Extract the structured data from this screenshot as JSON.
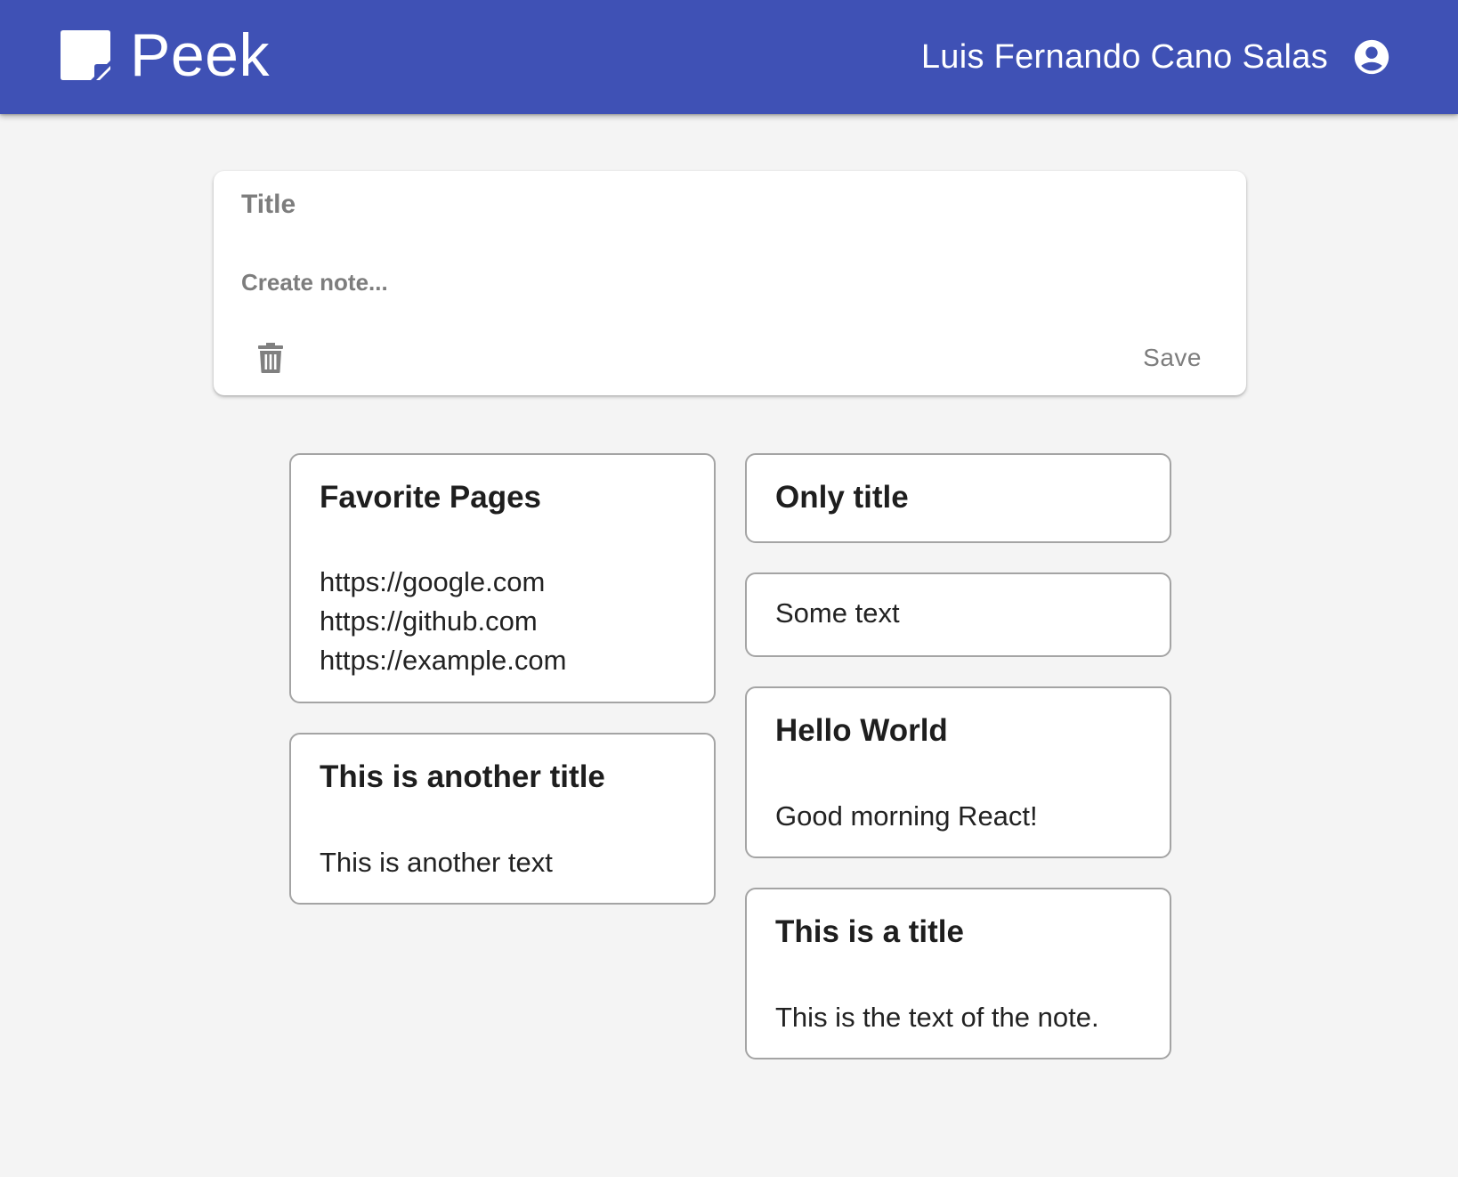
{
  "app": {
    "name": "Peek",
    "brand_icon": "sticky-note-icon",
    "accent_color": "#3f51b5"
  },
  "user": {
    "name": "Luis Fernando Cano Salas",
    "icon": "account-circle-icon"
  },
  "composer": {
    "title_placeholder": "Title",
    "note_placeholder": "Create note...",
    "delete_icon": "trash-icon",
    "save_label": "Save"
  },
  "notes": [
    {
      "title": "Favorite Pages",
      "text": "https://google.com\nhttps://github.com\nhttps://example.com"
    },
    {
      "title": "This is another title",
      "text": "This is another text"
    },
    {
      "title": "Only title",
      "text": ""
    },
    {
      "title": "",
      "text": "Some text"
    },
    {
      "title": "Hello World",
      "text": "Good morning React!"
    },
    {
      "title": "This is a title",
      "text": "This is the text of the note."
    }
  ]
}
